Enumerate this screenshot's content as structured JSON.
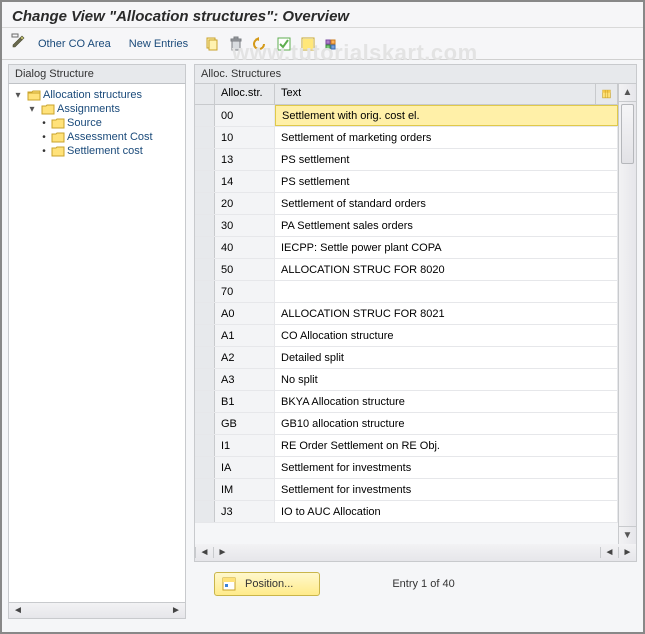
{
  "title": "Change View \"Allocation structures\": Overview",
  "toolbar": {
    "other_co_area": "Other CO Area",
    "new_entries": "New Entries"
  },
  "dialog_structure": {
    "title": "Dialog Structure",
    "root": "Allocation structures",
    "assignments": "Assignments",
    "children": [
      "Source",
      "Assessment Cost",
      "Settlement cost"
    ]
  },
  "grid": {
    "title": "Alloc. Structures",
    "col_code": "Alloc.str.",
    "col_text": "Text",
    "rows": [
      {
        "code": "00",
        "text": "Settlement with orig. cost el."
      },
      {
        "code": "10",
        "text": "Settlement of marketing orders"
      },
      {
        "code": "13",
        "text": "PS settlement"
      },
      {
        "code": "14",
        "text": "PS settlement"
      },
      {
        "code": "20",
        "text": "Settlement of standard orders"
      },
      {
        "code": "30",
        "text": "PA Settlement sales orders"
      },
      {
        "code": "40",
        "text": "IECPP: Settle power plant COPA"
      },
      {
        "code": "50",
        "text": "ALLOCATION STRUC FOR 8020"
      },
      {
        "code": "70",
        "text": ""
      },
      {
        "code": "A0",
        "text": "ALLOCATION STRUC FOR 8021"
      },
      {
        "code": "A1",
        "text": "CO Allocation structure"
      },
      {
        "code": "A2",
        "text": "Detailed split"
      },
      {
        "code": "A3",
        "text": "No split"
      },
      {
        "code": "B1",
        "text": "BKYA Allocation structure"
      },
      {
        "code": "GB",
        "text": "GB10 allocation structure"
      },
      {
        "code": "I1",
        "text": "RE Order Settlement on RE Obj."
      },
      {
        "code": "IA",
        "text": "Settlement for investments"
      },
      {
        "code": "IM",
        "text": "Settlement for investments"
      },
      {
        "code": "J3",
        "text": "IO to AUC Allocation"
      }
    ]
  },
  "footer": {
    "position_label": "Position...",
    "entry_info": "Entry 1 of 40"
  },
  "watermark": "www.tutorialskart.com"
}
